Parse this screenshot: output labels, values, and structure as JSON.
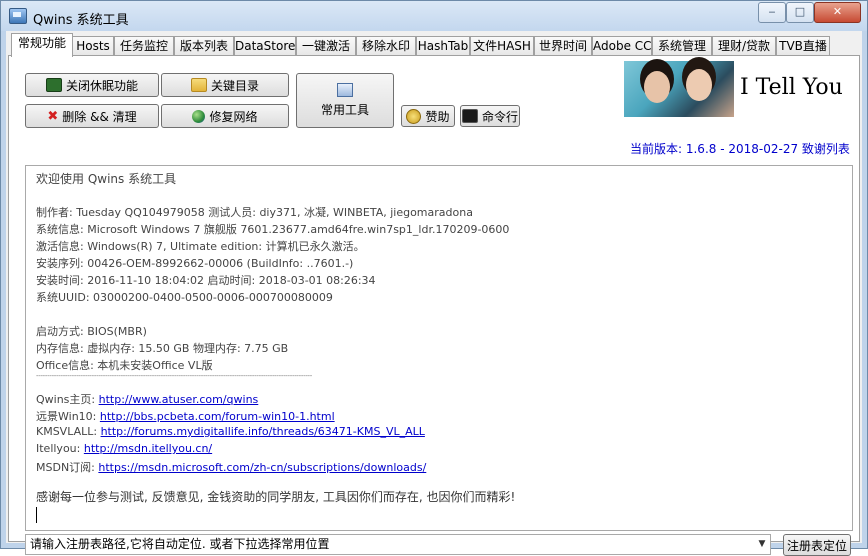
{
  "window": {
    "title": "Qwins 系统工具",
    "controls": {
      "minimize": "‒",
      "maximize": "□",
      "close": "✕"
    }
  },
  "tabs": [
    {
      "label": "常规功能",
      "active": true
    },
    {
      "label": "Hosts"
    },
    {
      "label": "任务监控"
    },
    {
      "label": "版本列表"
    },
    {
      "label": "DataStore"
    },
    {
      "label": "一键激活"
    },
    {
      "label": "移除水印"
    },
    {
      "label": "HashTab"
    },
    {
      "label": "文件HASH"
    },
    {
      "label": "世界时间"
    },
    {
      "label": "Adobe CC"
    },
    {
      "label": "系统管理"
    },
    {
      "label": "理财/贷款"
    },
    {
      "label": "TVB直播"
    }
  ],
  "buttons": {
    "hibernate": "关闭休眠功能",
    "key_dir": "关键目录",
    "delete_clean": "删除 && 清理",
    "repair_network": "修复网络",
    "common_tools": "常用工具",
    "sponsor": "赞助",
    "cmd": "命令行",
    "locate_registry": "注册表定位"
  },
  "banner": {
    "text": "I Tell You",
    "version_line": "当前版本: 1.6.8 - 2018-02-27  致谢列表"
  },
  "info": {
    "welcome": "欢迎使用 Qwins 系统工具",
    "makers": "制作者: Tuesday QQ104979058 测试人员: diy371, 冰凝, WINBETA, jiegomaradona",
    "system": "系统信息: Microsoft Windows 7 旗舰版  7601.23677.amd64fre.win7sp1_ldr.170209-0600",
    "activation": "激活信息: Windows(R) 7, Ultimate edition:  计算机已永久激活。",
    "serial": "安装序列: 00426-OEM-8992662-00006 (BuildInfo: ..7601.-)",
    "install_time": "安装时间: 2016-11-10 18:04:02 启动时间: 2018-03-01 08:26:34",
    "uuid": "系统UUID: 03000200-0400-0500-0006-000700080009",
    "boot": "启动方式: BIOS(MBR)",
    "memory": "内存信息: 虚拟内存: 15.50 GB 物理内存: 7.75 GB",
    "office": "Office信息: 本机未安装Office VL版",
    "separator": "----------------------------------------------------------------------------------------------------------------------------",
    "links": [
      {
        "label": "Qwins主页: ",
        "url": "http://www.atuser.com/qwins"
      },
      {
        "label": "远景Win10:  ",
        "url": "http://bbs.pcbeta.com/forum-win10-1.html"
      },
      {
        "label": "KMSVLALL: ",
        "url": "http://forums.mydigitallife.info/threads/63471-KMS_VL_ALL"
      },
      {
        "label": "Itellyou: ",
        "url": "http://msdn.itellyou.cn/"
      },
      {
        "label": "MSDN订阅: ",
        "url": "https://msdn.microsoft.com/zh-cn/subscriptions/downloads/"
      }
    ],
    "thanks": "感谢每一位参与测试, 反馈意见, 金钱资助的同学朋友, 工具因你们而存在, 也因你们而精彩!"
  },
  "registry_combo": {
    "value": "请输入注册表路径,它将自动定位. 或者下拉选择常用位置"
  }
}
